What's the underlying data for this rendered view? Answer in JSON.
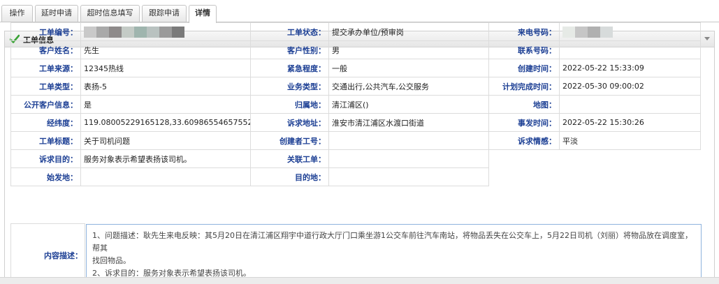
{
  "tabs": [
    "操作",
    "延时申请",
    "超时信息填写",
    "跟踪申请",
    "详情"
  ],
  "active_tab": 4,
  "panel": {
    "title": "工单信息",
    "icons": [
      "check-icon",
      "collapse-icon"
    ]
  },
  "rows": [
    [
      {
        "label": "工单编号：",
        "value": "",
        "masked": true
      },
      {
        "label": "工单状态：",
        "value": "提交承办单位/预审岗"
      },
      {
        "label": "来电号码：",
        "value": "",
        "masked": true
      }
    ],
    [
      {
        "label": "客户姓名：",
        "value": "先生"
      },
      {
        "label": "客户性别：",
        "value": "男"
      },
      {
        "label": "联系号码：",
        "value": ""
      }
    ],
    [
      {
        "label": "工单来源：",
        "value": "12345热线"
      },
      {
        "label": "紧急程度：",
        "value": "一般"
      },
      {
        "label": "创建时间：",
        "value": "2022-05-22 15:33:09"
      }
    ],
    [
      {
        "label": "工单类型：",
        "value": "表扬-5"
      },
      {
        "label": "业务类型：",
        "value": "交通出行,公共汽车,公交服务"
      },
      {
        "label": "计划完成时间：",
        "value": "2022-05-30 09:00:02"
      }
    ],
    [
      {
        "label": "公开客户信息：",
        "value": "是"
      },
      {
        "label": "归属地：",
        "value": "清江浦区()"
      },
      {
        "label": "地图：",
        "value": ""
      }
    ],
    [
      {
        "label": "经纬度：",
        "value": "119.08005229165128,33.60986554657552"
      },
      {
        "label": "诉求地址：",
        "value": "淮安市清江浦区水渡口街道"
      },
      {
        "label": "事发时间：",
        "value": "2022-05-22 15:30:26"
      }
    ],
    [
      {
        "label": "工单标题：",
        "value": "关于司机问题"
      },
      {
        "label": "创建者工号：",
        "value": ""
      },
      {
        "label": "诉求情感：",
        "value": "平淡"
      }
    ],
    [
      {
        "label": "诉求目的：",
        "value": "服务对象表示希望表扬该司机。"
      },
      {
        "label": "关联工单：",
        "value": ""
      }
    ],
    [
      {
        "label": "始发地：",
        "value": ""
      },
      {
        "label": "目的地：",
        "value": ""
      }
    ]
  ],
  "content": {
    "label": "内容描述：",
    "lines": [
      "1、问题描述：耿先生来电反映：其5月20日在清江浦区翔宇中道行政大厅门口乘坐游1公交车前往汽车南站，将物品丢失在公交车上，5月22日司机（刘丽）将物品放在调度室，帮其",
      "找回物品。",
      "2、诉求目的：服务对象表示希望表扬该司机。"
    ]
  },
  "colors": {
    "label": "#1c3f94",
    "border": "#dcdcdc",
    "check": "#3aa335",
    "content_border": "#8fb3dd"
  }
}
